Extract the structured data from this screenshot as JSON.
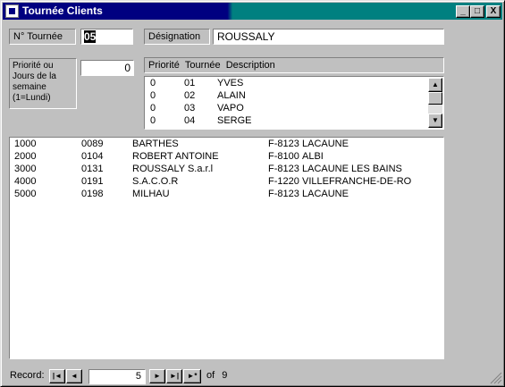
{
  "window": {
    "title": "Tournée Clients"
  },
  "title_buttons": {
    "minimize": "_",
    "maximize": "□",
    "close": "X"
  },
  "form": {
    "tournee_label": "N° Tournée",
    "tournee_value": "05",
    "designation_label": "Désignation",
    "designation_value": "ROUSSALY",
    "priorite_label_lines": [
      "Priorité ou",
      "Jours de la",
      "semaine",
      "(1=Lundi)"
    ],
    "priorite_value": "0"
  },
  "combo": {
    "headers": [
      "Priorité",
      "Tournée",
      "Description"
    ],
    "rows": [
      [
        "0",
        "01",
        "YVES"
      ],
      [
        "0",
        "02",
        "ALAIN"
      ],
      [
        "0",
        "03",
        "VAPO"
      ],
      [
        "0",
        "04",
        "SERGE"
      ]
    ]
  },
  "clients": [
    [
      "1000",
      "0089",
      "BARTHES",
      "F-8123",
      "LACAUNE"
    ],
    [
      "2000",
      "0104",
      "ROBERT ANTOINE",
      "F-8100",
      "ALBI"
    ],
    [
      "3000",
      "0131",
      "ROUSSALY S.a.r.l",
      "F-8123",
      "LACAUNE LES BAINS"
    ],
    [
      "4000",
      "0191",
      "S.A.C.O.R",
      "F-1220",
      "VILLEFRANCHE-DE-RO"
    ],
    [
      "5000",
      "0198",
      "MILHAU",
      "F-8123",
      "LACAUNE"
    ]
  ],
  "record_nav": {
    "label": "Record:",
    "current": "5",
    "of_label": "of",
    "total": "9",
    "buttons": {
      "first": "|◄",
      "prev": "◄",
      "next": "►",
      "last": "►|",
      "new": "►*"
    }
  }
}
